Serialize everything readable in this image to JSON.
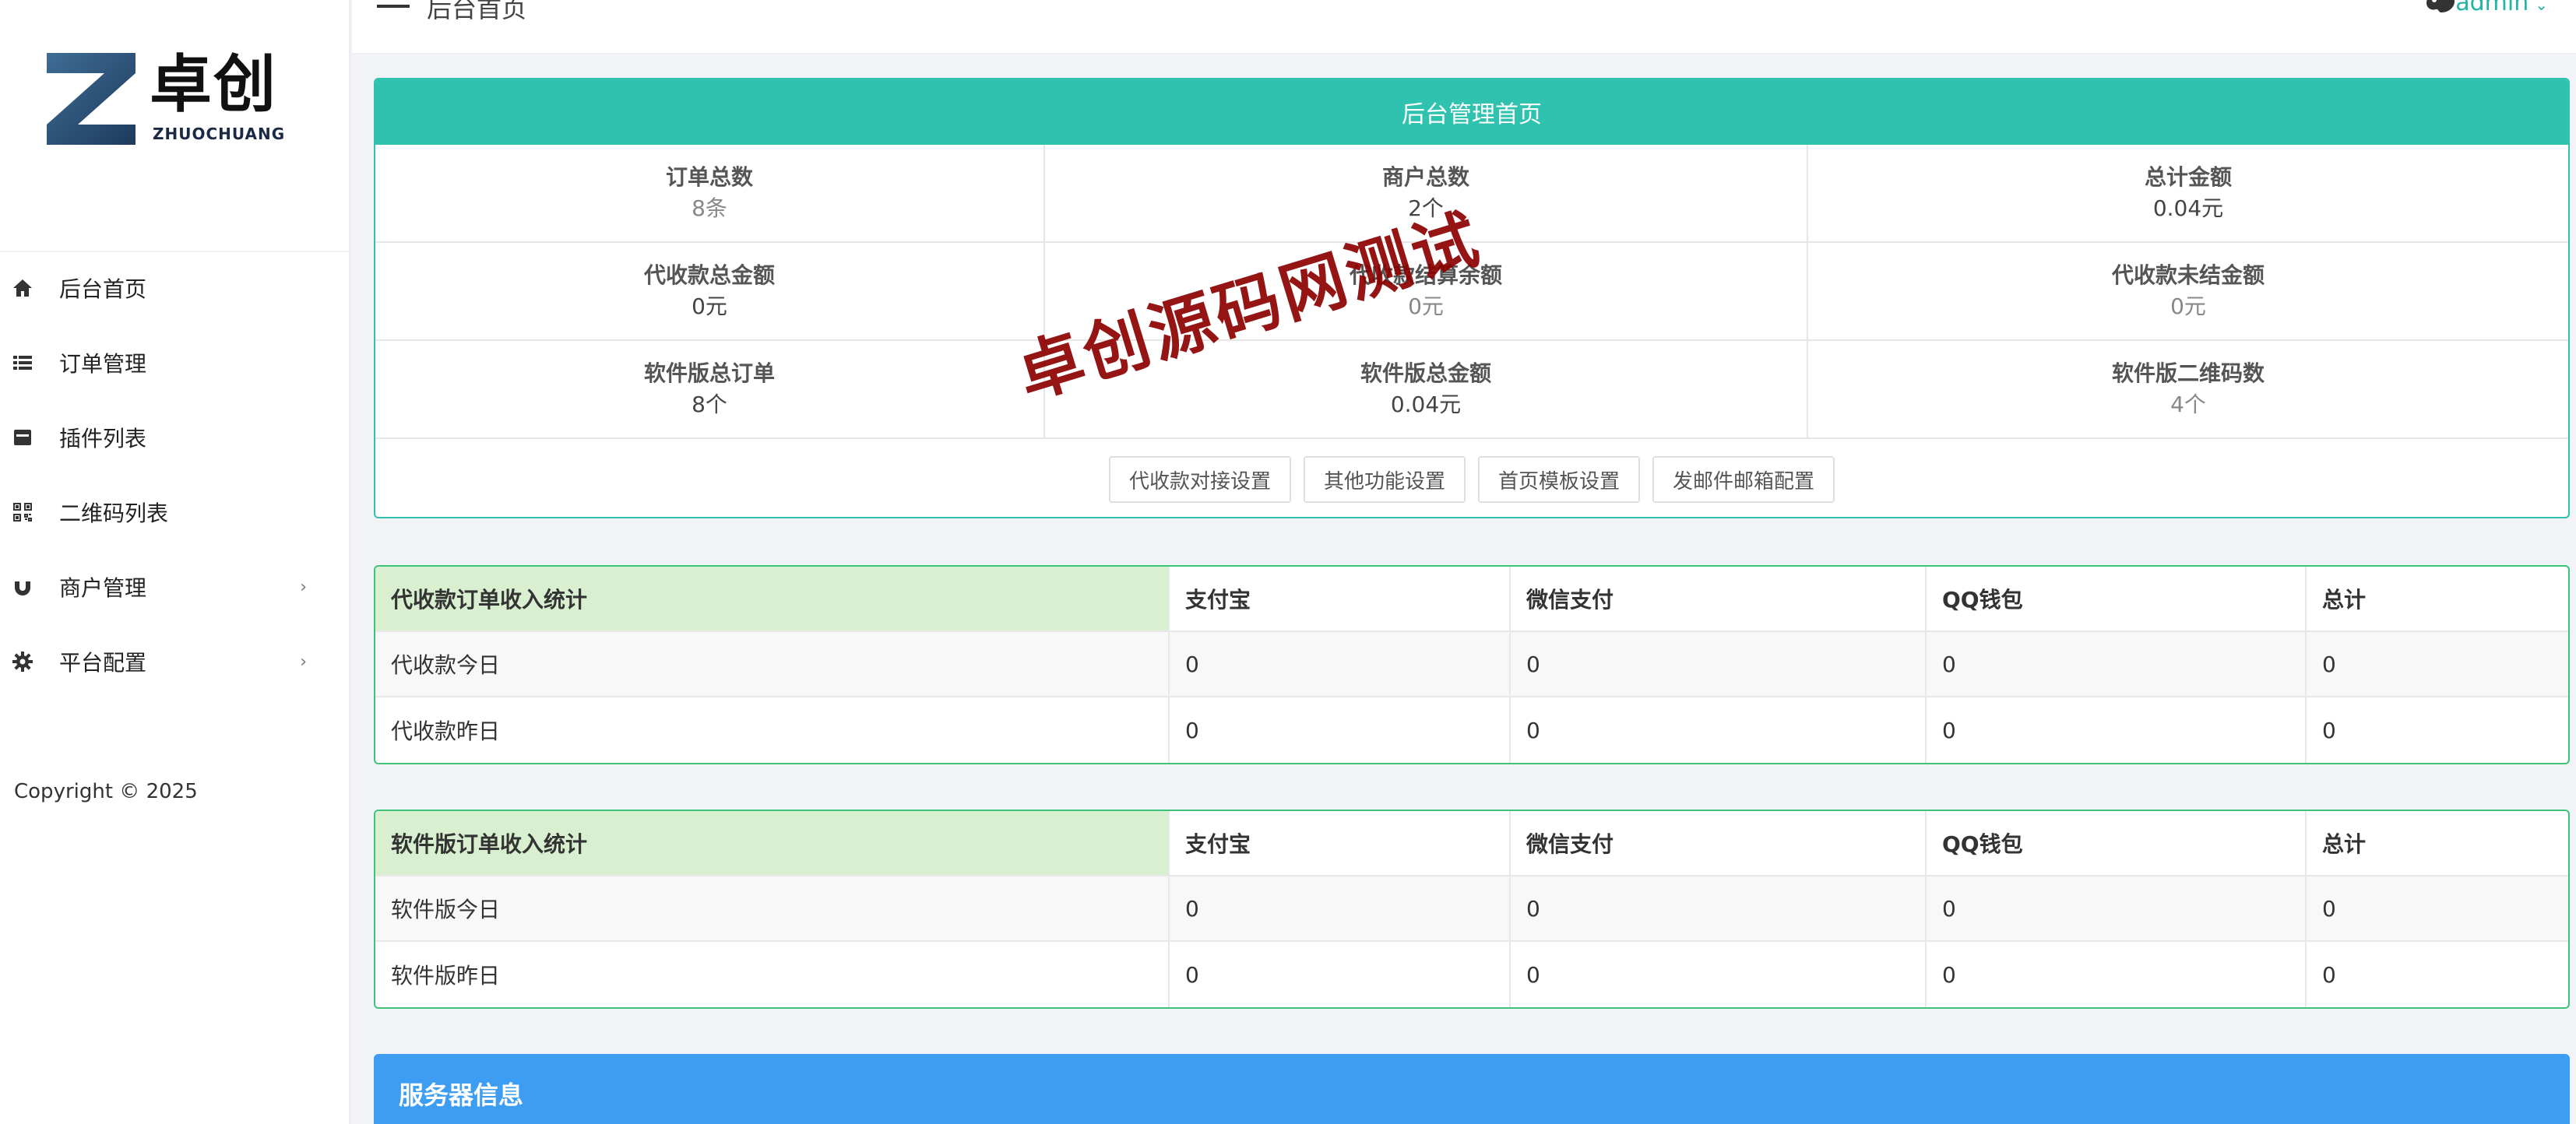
{
  "logo": {
    "cn_text": "卓创",
    "en_text": "ZHUOCHUANG"
  },
  "sidebar": {
    "items": [
      {
        "label": "后台首页",
        "icon": "home-icon",
        "has_arrow": false
      },
      {
        "label": "订单管理",
        "icon": "list-icon",
        "has_arrow": false
      },
      {
        "label": "插件列表",
        "icon": "archive-icon",
        "has_arrow": false
      },
      {
        "label": "二维码列表",
        "icon": "qrcode-icon",
        "has_arrow": false
      },
      {
        "label": "商户管理",
        "icon": "magnet-icon",
        "has_arrow": true
      },
      {
        "label": "平台配置",
        "icon": "gear-icon",
        "has_arrow": true
      }
    ],
    "arrow_glyph": "›",
    "copyright": "Copyright © 2025"
  },
  "topbar": {
    "title": "后台首页",
    "user": "admin",
    "caret": "⌄"
  },
  "stats": {
    "header": "后台管理首页",
    "rows": [
      [
        {
          "label": "订单总数",
          "value": "8条",
          "muted": true
        },
        {
          "label": "商户总数",
          "value": "2个",
          "muted": false
        },
        {
          "label": "总计金额",
          "value": "0.04元",
          "muted": false
        }
      ],
      [
        {
          "label": "代收款总金额",
          "value": "0元",
          "muted": false
        },
        {
          "label": "代收款结算余额",
          "value": "0元",
          "muted": true
        },
        {
          "label": "代收款未结金额",
          "value": "0元",
          "muted": true
        }
      ],
      [
        {
          "label": "软件版总订单",
          "value": "8个",
          "muted": false
        },
        {
          "label": "软件版总金额",
          "value": "0.04元",
          "muted": false
        },
        {
          "label": "软件版二维码数",
          "value": "4个",
          "muted": true
        }
      ]
    ],
    "buttons": [
      "代收款对接设置",
      "其他功能设置",
      "首页模板设置",
      "发邮件邮箱配置"
    ]
  },
  "daishou_table": {
    "headers": [
      "代收款订单收入统计",
      "支付宝",
      "微信支付",
      "QQ钱包",
      "总计"
    ],
    "rows": [
      [
        "代收款今日",
        "0",
        "0",
        "0",
        "0"
      ],
      [
        "代收款昨日",
        "0",
        "0",
        "0",
        "0"
      ]
    ]
  },
  "software_table": {
    "headers": [
      "软件版订单收入统计",
      "支付宝",
      "微信支付",
      "QQ钱包",
      "总计"
    ],
    "rows": [
      [
        "软件版今日",
        "0",
        "0",
        "0",
        "0"
      ],
      [
        "软件版昨日",
        "0",
        "0",
        "0",
        "0"
      ]
    ]
  },
  "server": {
    "title": "服务器信息"
  },
  "watermark": "卓创源码网测试",
  "colors": {
    "teal": "#2fc2ae",
    "green_border": "#3cc47a",
    "blue": "#3d9df2",
    "watermark": "#8c0000"
  }
}
